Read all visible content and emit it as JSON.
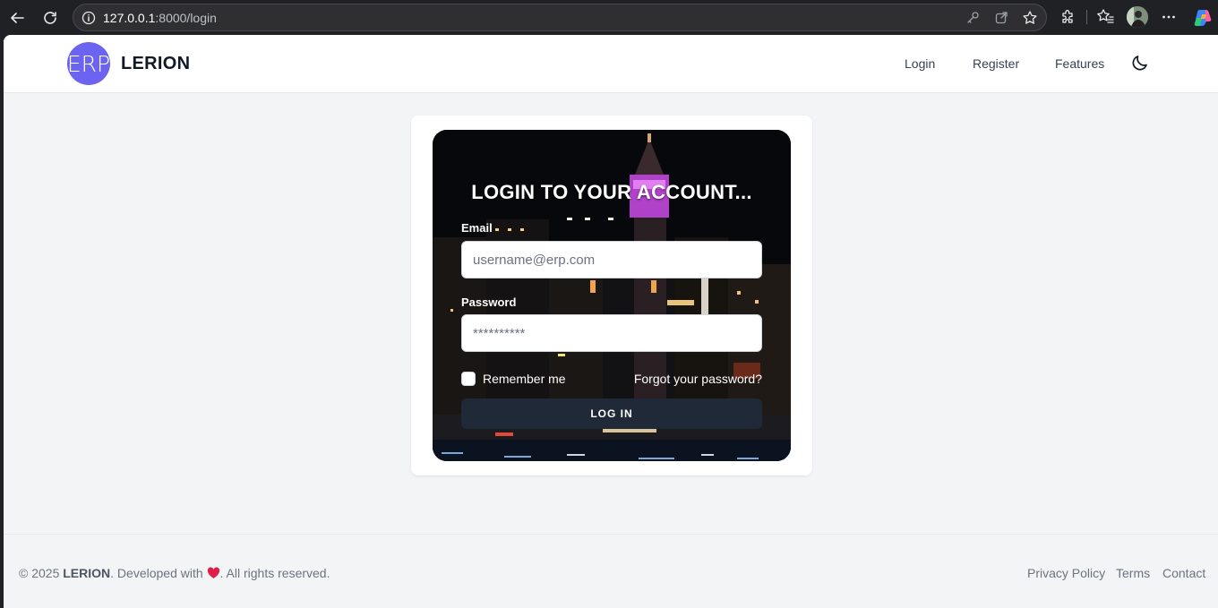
{
  "browser": {
    "url_host": "127.0.0.1",
    "url_rest": ":8000/login"
  },
  "nav": {
    "logo_text": "ERP",
    "brand": "LERION",
    "links": [
      "Login",
      "Register",
      "Features"
    ]
  },
  "login": {
    "title": "LOGIN TO YOUR ACCOUNT...",
    "email_label": "Email",
    "email_placeholder": "username@erp.com",
    "password_label": "Password",
    "password_placeholder": "**********",
    "remember_label": "Remember me",
    "forgot_label": "Forgot your password?",
    "submit_label": "LOG IN"
  },
  "footer": {
    "copyright_prefix": "© 2025 ",
    "brand": "LERION",
    "developed": ". Developed with ",
    "rights": ". All rights reserved.",
    "links": [
      "Privacy Policy",
      "Terms",
      "Contact"
    ]
  },
  "colors": {
    "accent": "#6c63f0",
    "button": "#1f2937",
    "page_bg": "#f3f4f6",
    "heart": "#e11d48"
  }
}
